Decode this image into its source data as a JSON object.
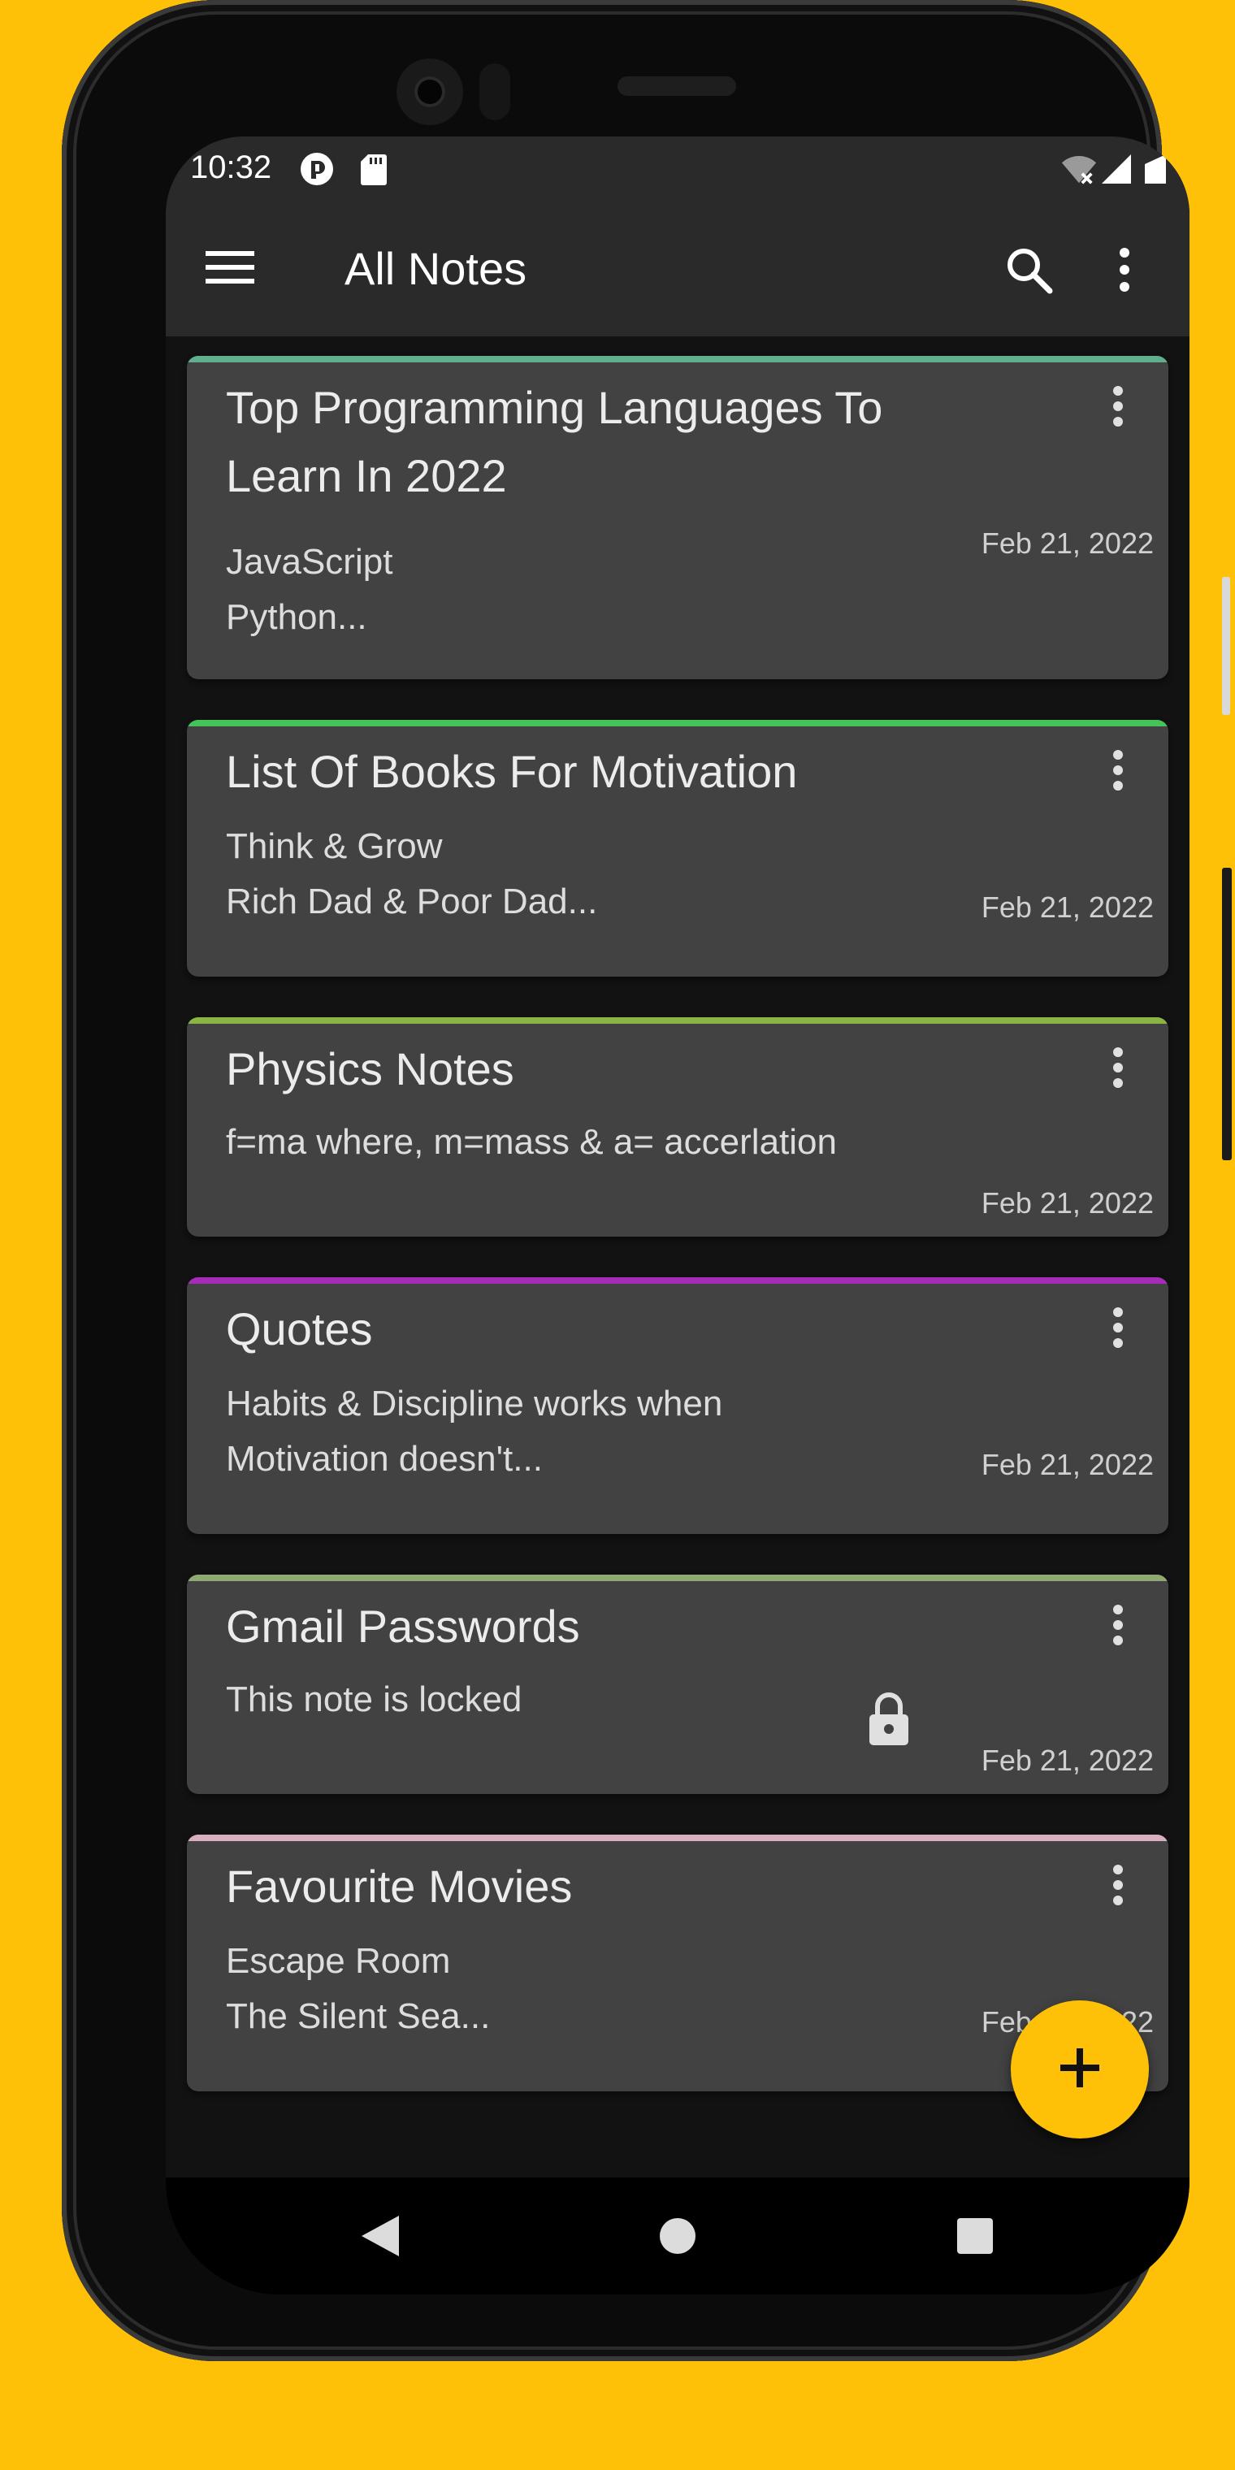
{
  "status_bar": {
    "time": "10:32",
    "icons": [
      "app-notification-icon",
      "sd-card-icon",
      "wifi-off-icon",
      "signal-icon",
      "battery-icon"
    ]
  },
  "app_bar": {
    "title": "All Notes",
    "menu_icon": "hamburger-menu-icon",
    "search_icon": "search-icon",
    "more_icon": "more-vert-icon"
  },
  "notes": [
    {
      "title": "Top Programming Languages To Learn In 2022",
      "body": " JavaScript\n Python...",
      "date": "Feb 21, 2022",
      "color": "#5FAE8E",
      "locked": false
    },
    {
      "title": "List Of Books For Motivation",
      "body": " Think & Grow\n Rich Dad & Poor Dad...",
      "date": "Feb 21, 2022",
      "color": "#45C35A",
      "locked": false
    },
    {
      "title": "Physics Notes",
      "body": "f=ma where, m=mass & a= accerlation",
      "date": "Feb 21, 2022",
      "color": "#8BB543",
      "locked": false
    },
    {
      "title": "Quotes",
      "body": " Habits & Discipline works when\nMotivation doesn't...",
      "date": "Feb 21, 2022",
      "color": "#A62BB8",
      "locked": false
    },
    {
      "title": "Gmail Passwords",
      "body": "This note is locked",
      "date": "Feb 21, 2022",
      "color": "#8FA874",
      "locked": true
    },
    {
      "title": "Favourite Movies",
      "body": " Escape Room\n The Silent Sea...",
      "date": "Feb 21, 2022",
      "color": "#D8AEC0",
      "locked": false
    }
  ],
  "fab": {
    "icon": "plus-icon",
    "color": "#FFC107"
  },
  "nav_bar": {
    "icons": [
      "back-icon",
      "home-icon",
      "recents-icon"
    ]
  },
  "colors": {
    "background": "#FFC107",
    "app_bar": "#2A2A2A",
    "card": "#424242",
    "screen": "#121212"
  }
}
